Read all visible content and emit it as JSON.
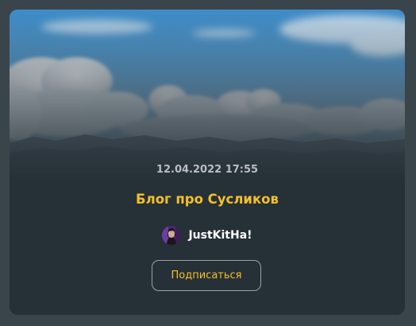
{
  "card": {
    "banner_image": "sky-clouds-mountains",
    "date": "12.04.2022 17:55",
    "title": "Блог про Сусликов",
    "author": {
      "name": "JustKitHa!",
      "avatar": "user-avatar"
    },
    "subscribe_label": "Подписаться"
  },
  "colors": {
    "page_background": "#3a444b",
    "card_background": "#263037",
    "title": "#f4c126",
    "date": "#b9bec2",
    "button_border": "#9aa2a8",
    "button_text": "#f4c126"
  }
}
